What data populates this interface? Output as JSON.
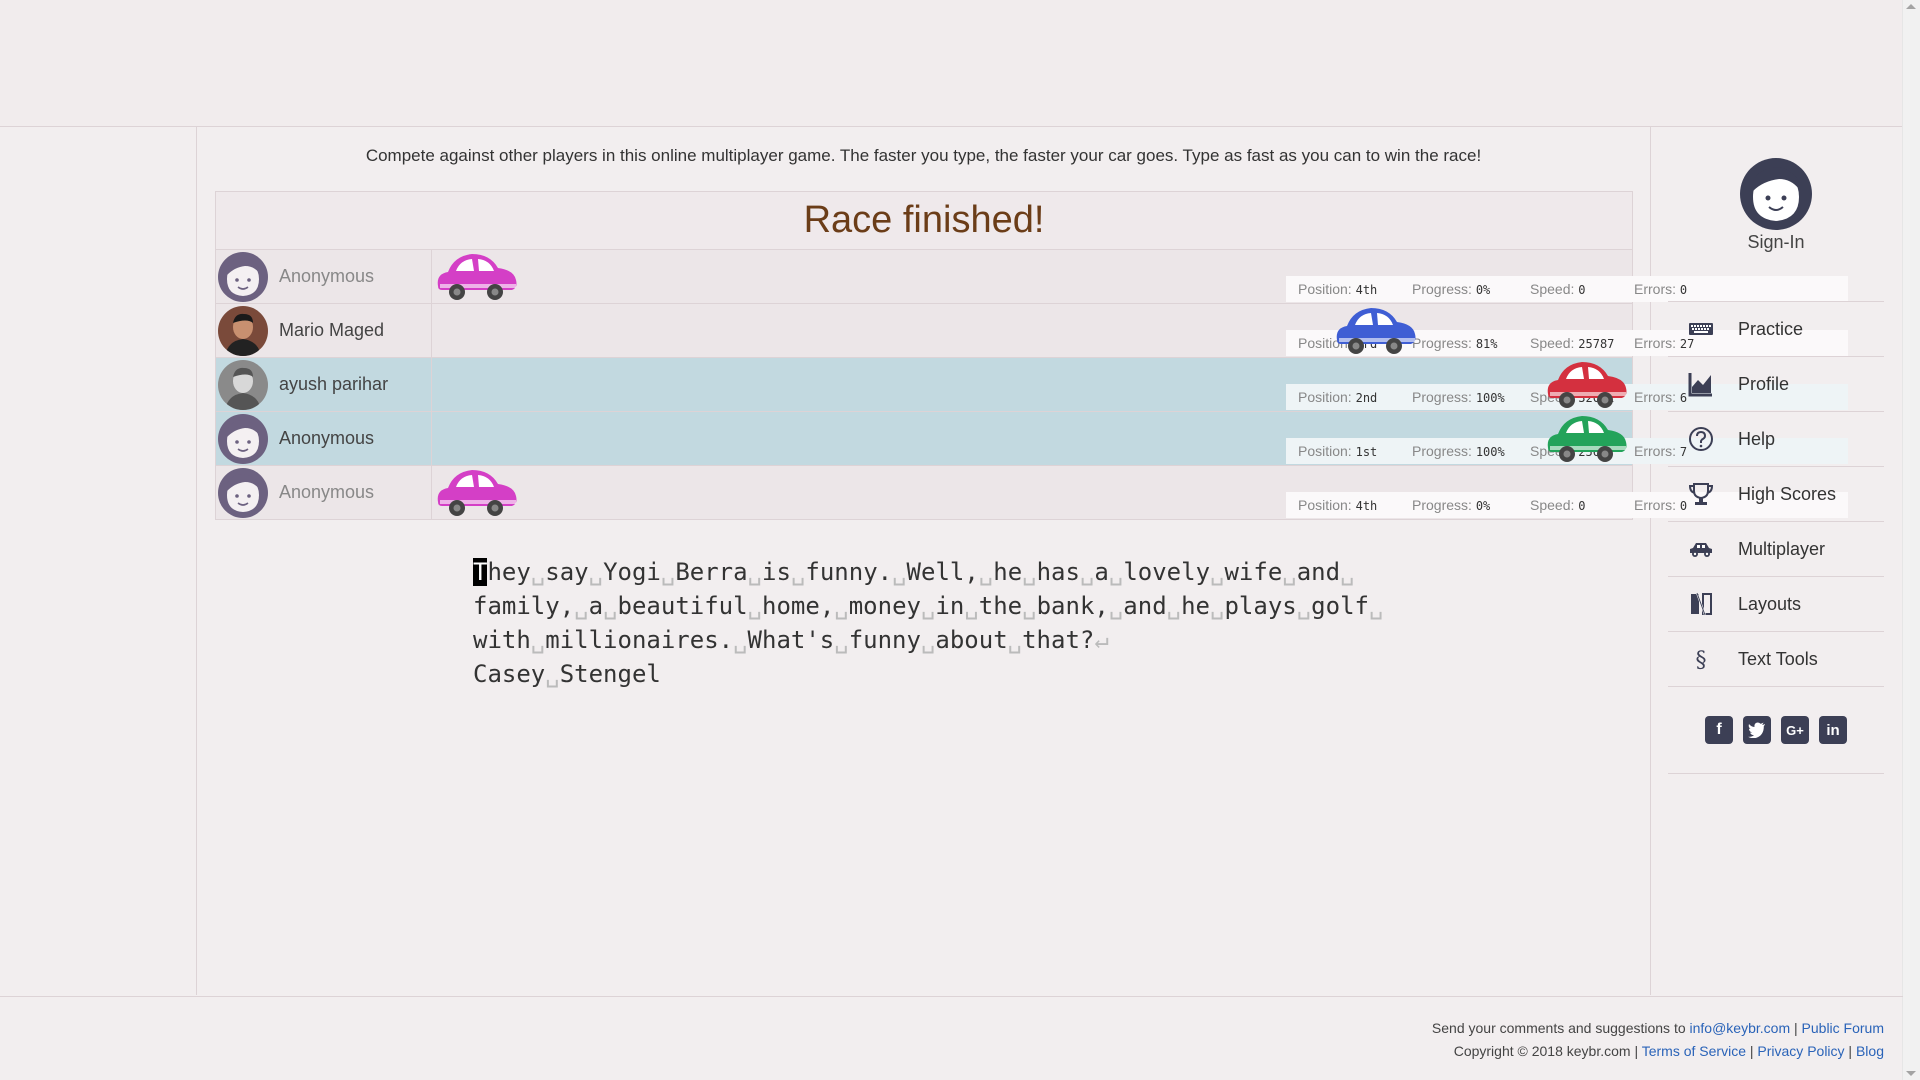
{
  "intro": "Compete against other players in this online multiplayer game. The faster you type, the faster your car goes. Type as fast as you can to win the race!",
  "race": {
    "title": "Race finished!",
    "labels": {
      "position": "Position:",
      "progress": "Progress:",
      "speed": "Speed:",
      "errors": "Errors:"
    },
    "players": [
      {
        "name": "Anonymous",
        "avatar": "anonymous-face",
        "position": "4th",
        "progress": "0%",
        "speed": "0",
        "errors": "0",
        "car_color": "#d43fc6",
        "highlight": false,
        "track_progress": 0.0
      },
      {
        "name": "Mario Maged",
        "avatar": "photo",
        "position": "3rd",
        "progress": "81%",
        "speed": "25787",
        "errors": "27",
        "car_color": "#3f5ed4",
        "highlight": false,
        "track_progress": 0.81
      },
      {
        "name": "ayush parihar",
        "avatar": "photo",
        "position": "2nd",
        "progress": "100%",
        "speed": "32022",
        "errors": "6",
        "car_color": "#d4303f",
        "highlight": true,
        "track_progress": 1.0
      },
      {
        "name": "Anonymous",
        "avatar": "anonymous-face",
        "position": "1st",
        "progress": "100%",
        "speed": "256",
        "errors": "7",
        "car_color": "#23a35a",
        "highlight": true,
        "track_progress": 1.0
      },
      {
        "name": "Anonymous",
        "avatar": "anonymous-face",
        "position": "4th",
        "progress": "0%",
        "speed": "0",
        "errors": "0",
        "car_color": "#d43fc6",
        "highlight": false,
        "track_progress": 0.0
      }
    ]
  },
  "typing_text": {
    "lines": [
      "They say Yogi Berra is funny. Well, he has a lovely wife and ",
      "family, a beautiful home, money in the bank, and he plays golf ",
      "with millionaires. What's funny about that?",
      "Casey Stengel"
    ],
    "newline_mark": "↵"
  },
  "sidebar": {
    "signin": "Sign-In",
    "items": [
      {
        "label": "Practice",
        "icon": "keyboard-icon"
      },
      {
        "label": "Profile",
        "icon": "chart-icon"
      },
      {
        "label": "Help",
        "icon": "help-icon"
      },
      {
        "label": "High Scores",
        "icon": "trophy-icon"
      },
      {
        "label": "Multiplayer",
        "icon": "car-icon"
      },
      {
        "label": "Layouts",
        "icon": "layouts-icon"
      },
      {
        "label": "Text Tools",
        "icon": "section-icon"
      }
    ],
    "social": [
      "facebook-icon",
      "twitter-icon",
      "google-plus-icon",
      "linkedin-icon"
    ]
  },
  "footer": {
    "line1_text": "Send your comments and suggestions to ",
    "email": "info@keybr.com",
    "sep": " | ",
    "forum": "Public Forum",
    "copyright": "Copyright © 2018 keybr.com",
    "terms": "Terms of Service",
    "privacy": "Privacy Policy",
    "blog": "Blog"
  }
}
